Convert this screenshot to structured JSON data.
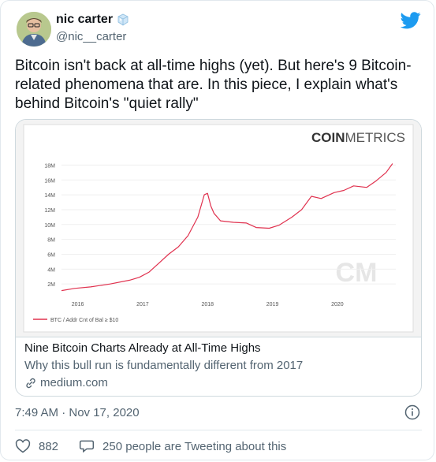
{
  "author": {
    "name": "nic carter",
    "badge_icon": "ice-cube-icon",
    "handle": "@nic__carter",
    "avatar_icon": "avatar-photo"
  },
  "brand_icon": "twitter-bird-icon",
  "brand_color": "#1d9bf0",
  "tweet_text": "Bitcoin isn't back at all-time highs (yet). But here's 9 Bitcoin-related phenomena that are. In this piece, I explain what's behind Bitcoin's \"quiet rally\"",
  "link_card": {
    "image_brand": "COINMETRICS",
    "image_watermark": "CM",
    "title": "Nine Bitcoin Charts Already at All-Time Highs",
    "description": "Why this bull run is fundamentally different from 2017",
    "domain": "medium.com",
    "domain_icon": "link-icon"
  },
  "chart_data": {
    "type": "line",
    "title": "",
    "xlabel": "",
    "ylabel": "",
    "y_tick_labels": [
      "2M",
      "4M",
      "6M",
      "8M",
      "10M",
      "12M",
      "14M",
      "16M",
      "18M"
    ],
    "x_tick_labels": [
      "2016",
      "2017",
      "2018",
      "2019",
      "2020"
    ],
    "ylim": [
      0,
      19
    ],
    "xlim": [
      2015.75,
      2020.9
    ],
    "legend": "bottom-left",
    "series": [
      {
        "name": "BTC / Addr Cnt of Bal ≥ $10",
        "color": "#e0324f",
        "x": [
          2015.75,
          2015.95,
          2016.2,
          2016.5,
          2016.8,
          2016.95,
          2017.1,
          2017.25,
          2017.4,
          2017.55,
          2017.7,
          2017.85,
          2017.95,
          2018.0,
          2018.05,
          2018.1,
          2018.2,
          2018.4,
          2018.6,
          2018.75,
          2018.95,
          2019.1,
          2019.3,
          2019.45,
          2019.6,
          2019.75,
          2019.95,
          2020.1,
          2020.25,
          2020.45,
          2020.6,
          2020.75,
          2020.85
        ],
        "y": [
          1.1,
          1.4,
          1.6,
          2.0,
          2.5,
          2.9,
          3.6,
          4.8,
          6.0,
          7.0,
          8.5,
          11.0,
          14.0,
          14.2,
          12.5,
          11.5,
          10.5,
          10.3,
          10.2,
          9.6,
          9.5,
          9.9,
          11.0,
          12.0,
          13.8,
          13.5,
          14.3,
          14.6,
          15.2,
          15.0,
          15.9,
          17.0,
          18.2
        ]
      }
    ]
  },
  "timestamp": "7:49 AM · Nov 17, 2020",
  "info_icon": "info-icon",
  "actions": {
    "likes_icon": "heart-icon",
    "likes_count": "882",
    "conversation_icon": "speech-bubble-icon",
    "conversation_text": "250 people are Tweeting about this"
  }
}
